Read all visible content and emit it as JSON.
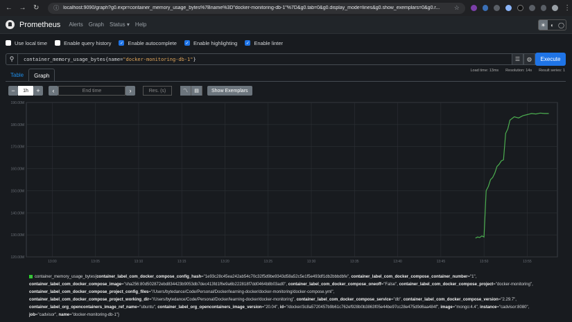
{
  "browser": {
    "url": "localhost:9090/graph?g0.expr=container_memory_usage_bytes%7Bname%3D\"docker-monitoring-db-1\"%7D&g0.tab=0&g0.display_mode=lines&g0.show_exemplars=0&g0.r..."
  },
  "navbar": {
    "brand": "Prometheus",
    "links": [
      "Alerts",
      "Graph",
      "Status ▾",
      "Help"
    ]
  },
  "options": [
    {
      "label": "Use local time",
      "checked": false
    },
    {
      "label": "Enable query history",
      "checked": false
    },
    {
      "label": "Enable autocomplete",
      "checked": true
    },
    {
      "label": "Enable highlighting",
      "checked": true
    },
    {
      "label": "Enable linter",
      "checked": true
    }
  ],
  "query": {
    "metric": "container_memory_usage_bytes{",
    "label": "name=",
    "value": "\"docker-monitoring-db-1\"",
    "close": "}",
    "execute_label": "Execute"
  },
  "stats": {
    "load_time": "Load time: 13ms",
    "resolution": "Resolution: 14s",
    "result_series": "Result series: 1"
  },
  "tabs": {
    "table": "Table",
    "graph": "Graph"
  },
  "controls": {
    "minus": "−",
    "range": "1h",
    "plus": "+",
    "prev": "‹",
    "end_time_placeholder": "End time",
    "next": "›",
    "res_placeholder": "Res. (s)",
    "show_exemplars": "Show Exemplars"
  },
  "chart_data": {
    "type": "line",
    "yticks": [
      "190.00M",
      "180.00M",
      "170.00M",
      "160.00M",
      "150.00M",
      "140.00M",
      "130.00M",
      "120.00M"
    ],
    "xticks": [
      "13:00",
      "13:05",
      "13:10",
      "13:15",
      "13:20",
      "13:25",
      "13:30",
      "13:35",
      "13:40",
      "13:45",
      "13:50",
      "13:55"
    ],
    "ylim": [
      120,
      190
    ],
    "y_unit": "M",
    "series": [
      {
        "color": "#4caf50",
        "x": [
          "13:49:00",
          "13:49:15",
          "13:49:30",
          "13:49:45",
          "13:50:00",
          "13:50:15",
          "13:50:30",
          "13:50:45",
          "13:51:00",
          "13:51:15",
          "13:51:30",
          "13:51:45",
          "13:52:00",
          "13:52:15",
          "13:52:30",
          "13:52:45",
          "13:53:00",
          "13:53:30",
          "13:54:00",
          "13:54:30",
          "13:55:00",
          "13:55:30",
          "13:56:00",
          "13:56:30",
          "13:57:00",
          "13:57:30"
        ],
        "y": [
          128.5,
          129,
          128.8,
          129.5,
          129,
          150,
          152,
          155,
          156,
          158,
          161,
          162,
          163.5,
          164,
          176,
          178,
          182,
          183.5,
          183,
          184,
          184.5,
          185,
          184.8,
          185.2,
          185,
          185
        ]
      }
    ]
  },
  "legend": {
    "color": "#4caf50",
    "metric": "container_memory_usage_bytes",
    "labels": [
      {
        "k": "container_label_com_docker_compose_config_hash",
        "v": "\"1e93c28c45ea242ab54c70c32f5d9be9343d58a52c5e1f5e493df1db2bbbdbfe\""
      },
      {
        "k": "container_label_com_docker_compose_container_number",
        "v": "\"1\""
      },
      {
        "k": "container_label_com_docker_compose_image",
        "v": "\"sha256:80d502872ebd834423b9053db7dec413fd1f6e9a6b222818f7dd0464b8b03ad0\""
      },
      {
        "k": "container_label_com_docker_compose_oneoff",
        "v": "\"False\""
      },
      {
        "k": "container_label_com_docker_compose_project",
        "v": "\"docker-monitoring\""
      },
      {
        "k": "container_label_com_docker_compose_project_config_files",
        "v": "\"/Users/bytedance/Code/Personal/Docker/learning-docker/docker-monitoring/docker-compose.yml\""
      },
      {
        "k": "container_label_com_docker_compose_project_working_dir",
        "v": "\"/Users/bytedance/Code/Personal/Docker/learning-docker/docker-monitoring\""
      },
      {
        "k": "container_label_com_docker_compose_service",
        "v": "\"db\""
      },
      {
        "k": "container_label_com_docker_compose_version",
        "v": "\"2.29.7\""
      },
      {
        "k": "container_label_org_opencontainers_image_ref_name",
        "v": "\"ubuntu\""
      },
      {
        "k": "container_label_org_opencontainers_image_version",
        "v": "\"20.04\""
      },
      {
        "k": "id",
        "v": "\"/docker/3c8a5720457b9b61c762ef928b0b3863f05e44be97cc28e475d9d6aa484f\""
      },
      {
        "k": "image",
        "v": "\"mongo:4.4\""
      },
      {
        "k": "instance",
        "v": "\"cadvisor:8080\""
      },
      {
        "k": "job",
        "v": "\"cadvisor\""
      },
      {
        "k": "name",
        "v": "\"docker-monitoring-db-1\""
      }
    ]
  }
}
